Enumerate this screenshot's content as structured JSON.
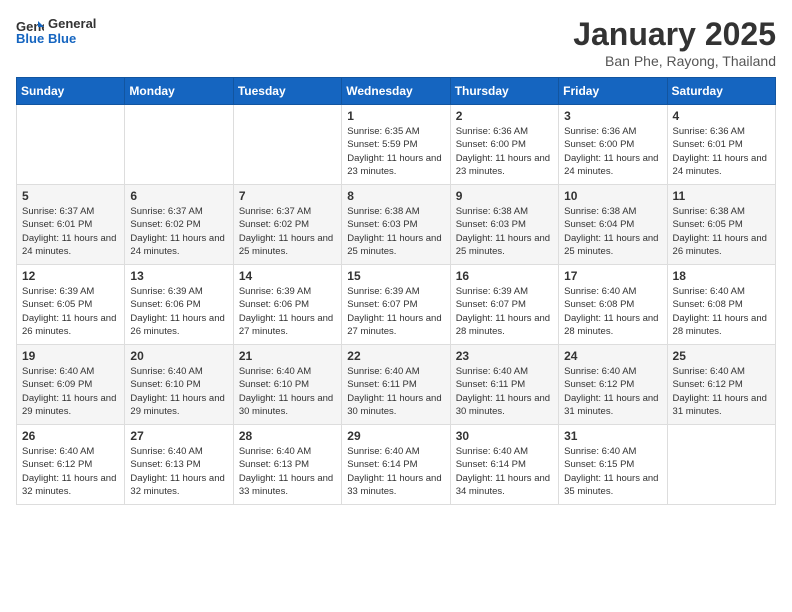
{
  "header": {
    "logo_general": "General",
    "logo_blue": "Blue",
    "calendar_title": "January 2025",
    "calendar_subtitle": "Ban Phe, Rayong, Thailand"
  },
  "weekdays": [
    "Sunday",
    "Monday",
    "Tuesday",
    "Wednesday",
    "Thursday",
    "Friday",
    "Saturday"
  ],
  "weeks": [
    [
      {
        "day": "",
        "sunrise": "",
        "sunset": "",
        "daylight": ""
      },
      {
        "day": "",
        "sunrise": "",
        "sunset": "",
        "daylight": ""
      },
      {
        "day": "",
        "sunrise": "",
        "sunset": "",
        "daylight": ""
      },
      {
        "day": "1",
        "sunrise": "Sunrise: 6:35 AM",
        "sunset": "Sunset: 5:59 PM",
        "daylight": "Daylight: 11 hours and 23 minutes."
      },
      {
        "day": "2",
        "sunrise": "Sunrise: 6:36 AM",
        "sunset": "Sunset: 6:00 PM",
        "daylight": "Daylight: 11 hours and 23 minutes."
      },
      {
        "day": "3",
        "sunrise": "Sunrise: 6:36 AM",
        "sunset": "Sunset: 6:00 PM",
        "daylight": "Daylight: 11 hours and 24 minutes."
      },
      {
        "day": "4",
        "sunrise": "Sunrise: 6:36 AM",
        "sunset": "Sunset: 6:01 PM",
        "daylight": "Daylight: 11 hours and 24 minutes."
      }
    ],
    [
      {
        "day": "5",
        "sunrise": "Sunrise: 6:37 AM",
        "sunset": "Sunset: 6:01 PM",
        "daylight": "Daylight: 11 hours and 24 minutes."
      },
      {
        "day": "6",
        "sunrise": "Sunrise: 6:37 AM",
        "sunset": "Sunset: 6:02 PM",
        "daylight": "Daylight: 11 hours and 24 minutes."
      },
      {
        "day": "7",
        "sunrise": "Sunrise: 6:37 AM",
        "sunset": "Sunset: 6:02 PM",
        "daylight": "Daylight: 11 hours and 25 minutes."
      },
      {
        "day": "8",
        "sunrise": "Sunrise: 6:38 AM",
        "sunset": "Sunset: 6:03 PM",
        "daylight": "Daylight: 11 hours and 25 minutes."
      },
      {
        "day": "9",
        "sunrise": "Sunrise: 6:38 AM",
        "sunset": "Sunset: 6:03 PM",
        "daylight": "Daylight: 11 hours and 25 minutes."
      },
      {
        "day": "10",
        "sunrise": "Sunrise: 6:38 AM",
        "sunset": "Sunset: 6:04 PM",
        "daylight": "Daylight: 11 hours and 25 minutes."
      },
      {
        "day": "11",
        "sunrise": "Sunrise: 6:38 AM",
        "sunset": "Sunset: 6:05 PM",
        "daylight": "Daylight: 11 hours and 26 minutes."
      }
    ],
    [
      {
        "day": "12",
        "sunrise": "Sunrise: 6:39 AM",
        "sunset": "Sunset: 6:05 PM",
        "daylight": "Daylight: 11 hours and 26 minutes."
      },
      {
        "day": "13",
        "sunrise": "Sunrise: 6:39 AM",
        "sunset": "Sunset: 6:06 PM",
        "daylight": "Daylight: 11 hours and 26 minutes."
      },
      {
        "day": "14",
        "sunrise": "Sunrise: 6:39 AM",
        "sunset": "Sunset: 6:06 PM",
        "daylight": "Daylight: 11 hours and 27 minutes."
      },
      {
        "day": "15",
        "sunrise": "Sunrise: 6:39 AM",
        "sunset": "Sunset: 6:07 PM",
        "daylight": "Daylight: 11 hours and 27 minutes."
      },
      {
        "day": "16",
        "sunrise": "Sunrise: 6:39 AM",
        "sunset": "Sunset: 6:07 PM",
        "daylight": "Daylight: 11 hours and 28 minutes."
      },
      {
        "day": "17",
        "sunrise": "Sunrise: 6:40 AM",
        "sunset": "Sunset: 6:08 PM",
        "daylight": "Daylight: 11 hours and 28 minutes."
      },
      {
        "day": "18",
        "sunrise": "Sunrise: 6:40 AM",
        "sunset": "Sunset: 6:08 PM",
        "daylight": "Daylight: 11 hours and 28 minutes."
      }
    ],
    [
      {
        "day": "19",
        "sunrise": "Sunrise: 6:40 AM",
        "sunset": "Sunset: 6:09 PM",
        "daylight": "Daylight: 11 hours and 29 minutes."
      },
      {
        "day": "20",
        "sunrise": "Sunrise: 6:40 AM",
        "sunset": "Sunset: 6:10 PM",
        "daylight": "Daylight: 11 hours and 29 minutes."
      },
      {
        "day": "21",
        "sunrise": "Sunrise: 6:40 AM",
        "sunset": "Sunset: 6:10 PM",
        "daylight": "Daylight: 11 hours and 30 minutes."
      },
      {
        "day": "22",
        "sunrise": "Sunrise: 6:40 AM",
        "sunset": "Sunset: 6:11 PM",
        "daylight": "Daylight: 11 hours and 30 minutes."
      },
      {
        "day": "23",
        "sunrise": "Sunrise: 6:40 AM",
        "sunset": "Sunset: 6:11 PM",
        "daylight": "Daylight: 11 hours and 30 minutes."
      },
      {
        "day": "24",
        "sunrise": "Sunrise: 6:40 AM",
        "sunset": "Sunset: 6:12 PM",
        "daylight": "Daylight: 11 hours and 31 minutes."
      },
      {
        "day": "25",
        "sunrise": "Sunrise: 6:40 AM",
        "sunset": "Sunset: 6:12 PM",
        "daylight": "Daylight: 11 hours and 31 minutes."
      }
    ],
    [
      {
        "day": "26",
        "sunrise": "Sunrise: 6:40 AM",
        "sunset": "Sunset: 6:12 PM",
        "daylight": "Daylight: 11 hours and 32 minutes."
      },
      {
        "day": "27",
        "sunrise": "Sunrise: 6:40 AM",
        "sunset": "Sunset: 6:13 PM",
        "daylight": "Daylight: 11 hours and 32 minutes."
      },
      {
        "day": "28",
        "sunrise": "Sunrise: 6:40 AM",
        "sunset": "Sunset: 6:13 PM",
        "daylight": "Daylight: 11 hours and 33 minutes."
      },
      {
        "day": "29",
        "sunrise": "Sunrise: 6:40 AM",
        "sunset": "Sunset: 6:14 PM",
        "daylight": "Daylight: 11 hours and 33 minutes."
      },
      {
        "day": "30",
        "sunrise": "Sunrise: 6:40 AM",
        "sunset": "Sunset: 6:14 PM",
        "daylight": "Daylight: 11 hours and 34 minutes."
      },
      {
        "day": "31",
        "sunrise": "Sunrise: 6:40 AM",
        "sunset": "Sunset: 6:15 PM",
        "daylight": "Daylight: 11 hours and 35 minutes."
      },
      {
        "day": "",
        "sunrise": "",
        "sunset": "",
        "daylight": ""
      }
    ]
  ]
}
